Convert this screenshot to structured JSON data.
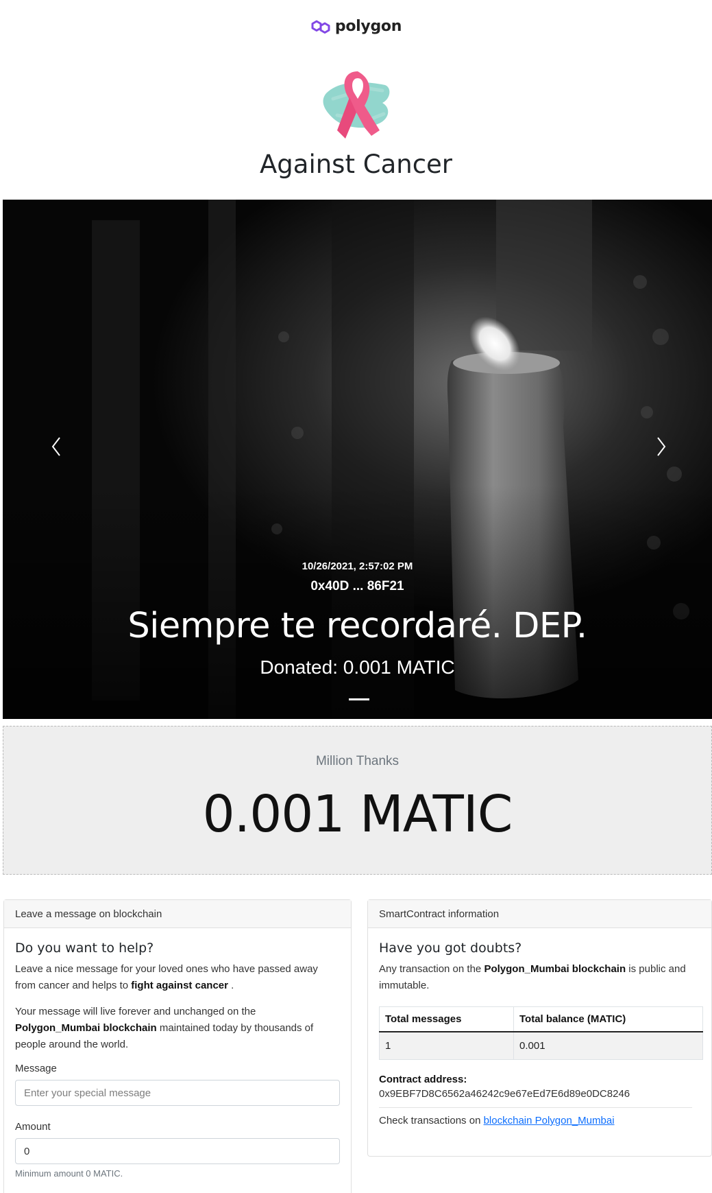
{
  "header": {
    "brand_name": "polygon",
    "brand_color": "#8247e5",
    "logo_icon": "ribbon-icon",
    "title": "Against Cancer"
  },
  "carousel": {
    "prev_icon": "chevron-left-icon",
    "next_icon": "chevron-right-icon",
    "slide": {
      "date": "10/26/2021, 2:57:02 PM",
      "address": "0x40D ... 86F21",
      "message": "Siempre te recordaré. DEP.",
      "donated": "Donated: 0.001 MATIC"
    }
  },
  "thanks": {
    "label": "Million Thanks",
    "amount": "0.001 MATIC"
  },
  "message_card": {
    "header": "Leave a message on blockchain",
    "title": "Do you want to help?",
    "p1_prefix": "Leave a nice message for your loved ones who have passed away from cancer and helps to ",
    "p1_bold": "fight against cancer",
    "p1_suffix": " .",
    "p2_prefix": "Your message will live forever and unchanged on the ",
    "p2_bold": "Polygon_Mumbai blockchain",
    "p2_suffix": " maintained today by thousands of people around the world.",
    "message_label": "Message",
    "message_placeholder": "Enter your special message",
    "amount_label": "Amount",
    "amount_value": "0",
    "amount_help": "Minimum amount 0 MATIC."
  },
  "contract_card": {
    "header": "SmartContract information",
    "title": "Have you got doubts?",
    "p_prefix": "Any transaction on the ",
    "p_bold": "Polygon_Mumbai blockchain",
    "p_suffix": " is public and immutable.",
    "table": {
      "headers": [
        "Total messages",
        "Total balance (MATIC)"
      ],
      "rows": [
        [
          "1",
          "0.001"
        ]
      ]
    },
    "address_label": "Contract address:",
    "address_value": "0x9EBF7D8C6562a46242c9e67eEd7E6d89e0DC8246",
    "check_prefix": "Check transactions on ",
    "check_link": "blockchain Polygon_Mumbai"
  }
}
